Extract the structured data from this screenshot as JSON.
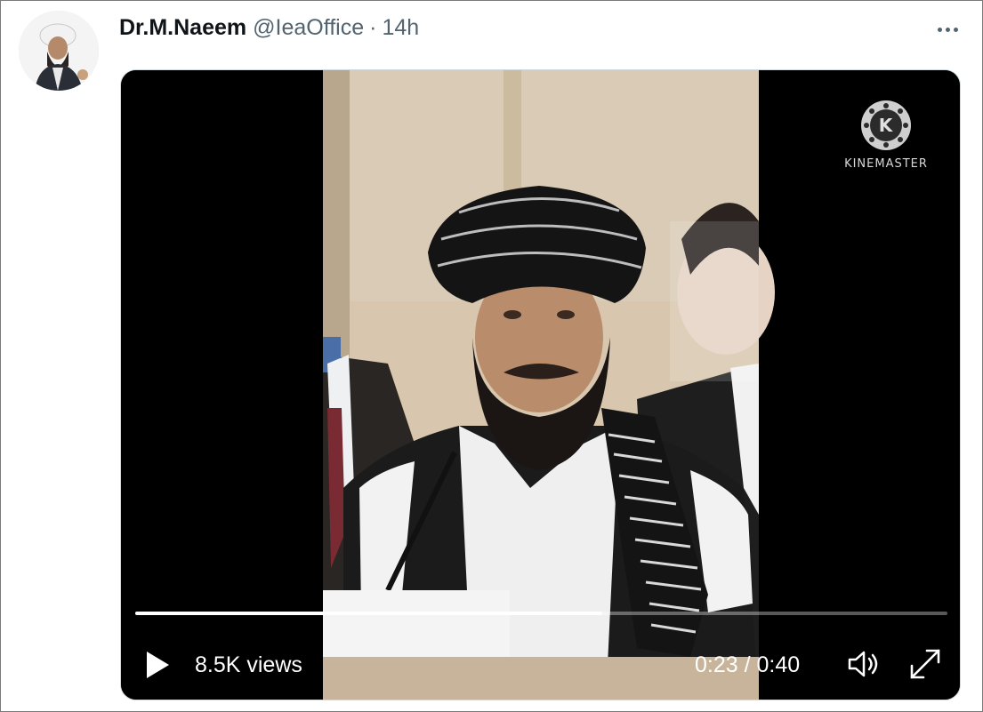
{
  "tweet": {
    "author_name": "Dr.M.Naeem",
    "handle": "@IeaOffice",
    "separator": "·",
    "time_ago": "14h",
    "more_icon": "more-horizontal-icon"
  },
  "video": {
    "watermark_text": "KINEMASTER",
    "watermark_letter": "K",
    "views": "8.5K views",
    "current_time": "0:23",
    "time_separator": "/",
    "duration": "0:40",
    "progress_fraction": 0.575,
    "play_icon": "play-icon",
    "volume_icon": "volume-icon",
    "fullscreen_icon": "fullscreen-icon"
  },
  "colors": {
    "secondary_text": "#536471",
    "primary_text": "#0f1419",
    "video_bg": "#000000",
    "progress_fill": "#ffffff"
  }
}
